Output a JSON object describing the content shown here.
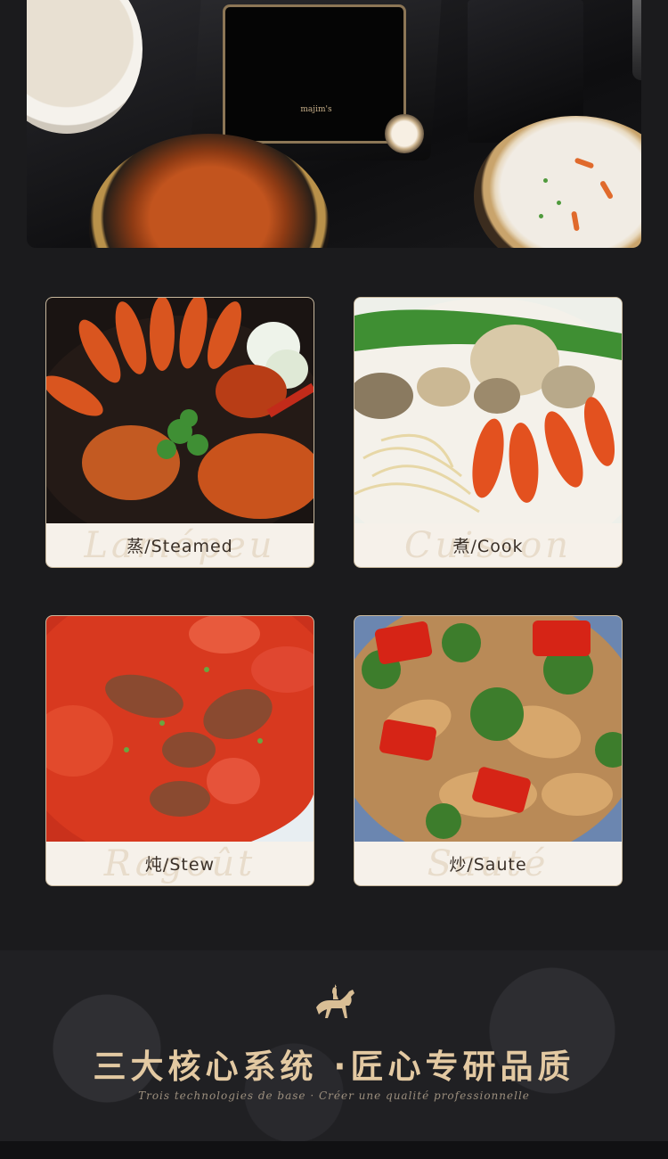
{
  "hero": {
    "brand_text": "majim's",
    "image": "smart-cooking-machine-with-dishes"
  },
  "cards": [
    {
      "label": "蒸/Steamed",
      "script": "Lamépeu",
      "image": "steamed-crab-and-shrimp"
    },
    {
      "label": "煮/Cook",
      "script": "Cuisson",
      "image": "seafood-noodle-soup"
    },
    {
      "label": "炖/Stew",
      "script": "Ragoût",
      "image": "tomato-beef-stew"
    },
    {
      "label": "炒/Saute",
      "script": "Sauté",
      "image": "stir-fried-chicken-broccoli"
    }
  ],
  "footer": {
    "icon": "horse-rider-icon",
    "headline": "三大核心系统 ·匠心专研品质",
    "subline": "Trois technologies de base · Créer une qualité professionnelle"
  }
}
